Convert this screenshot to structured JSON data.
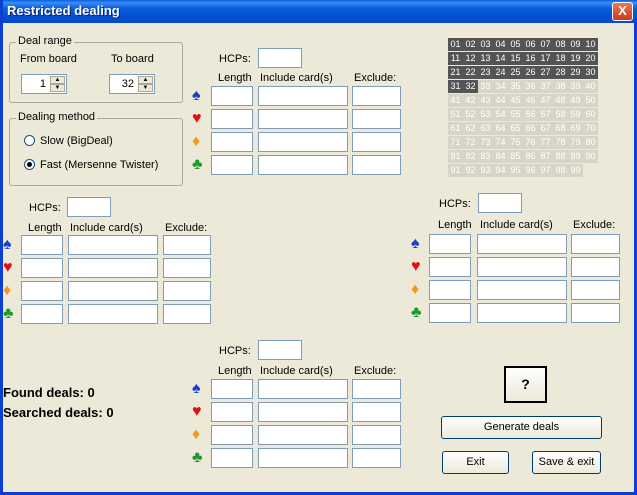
{
  "window": {
    "title": "Restricted dealing",
    "close_glyph": "X"
  },
  "deal_range": {
    "title": "Deal range",
    "from_label": "From board",
    "to_label": "To board",
    "from_value": "1",
    "to_value": "32"
  },
  "dealing_method": {
    "title": "Dealing method",
    "options": [
      {
        "label": "Slow (BigDeal)",
        "selected": false
      },
      {
        "label": "Fast (Mersenne Twister)",
        "selected": true
      }
    ]
  },
  "hand_labels": {
    "hcps": "HCPs:",
    "length": "Length",
    "include": "Include card(s)",
    "exclude": "Exclude:"
  },
  "suits": [
    {
      "glyph": "♠",
      "color": "#1a3fcf"
    },
    {
      "glyph": "♥",
      "color": "#e01010"
    },
    {
      "glyph": "♦",
      "color": "#f39a1c"
    },
    {
      "glyph": "♣",
      "color": "#1e9a2a"
    }
  ],
  "board_grid": {
    "cells": [
      "01",
      "02",
      "03",
      "04",
      "05",
      "06",
      "07",
      "08",
      "09",
      "10",
      "11",
      "12",
      "13",
      "14",
      "15",
      "16",
      "17",
      "18",
      "19",
      "20",
      "21",
      "22",
      "23",
      "24",
      "25",
      "26",
      "27",
      "28",
      "29",
      "30",
      "31",
      "32",
      "33",
      "34",
      "35",
      "36",
      "37",
      "38",
      "39",
      "40",
      "41",
      "42",
      "43",
      "44",
      "45",
      "46",
      "47",
      "48",
      "49",
      "50",
      "51",
      "52",
      "53",
      "54",
      "55",
      "56",
      "57",
      "58",
      "59",
      "60",
      "61",
      "62",
      "63",
      "64",
      "65",
      "66",
      "67",
      "68",
      "69",
      "70",
      "71",
      "72",
      "73",
      "74",
      "75",
      "76",
      "77",
      "78",
      "79",
      "80",
      "81",
      "82",
      "83",
      "84",
      "85",
      "86",
      "87",
      "88",
      "89",
      "90",
      "91",
      "92",
      "93",
      "94",
      "95",
      "96",
      "97",
      "98",
      "99"
    ],
    "active_count": 32,
    "active_color": "#545454",
    "inactive_color": "#d8d5c7"
  },
  "stats": {
    "found": "Found deals: 0",
    "searched": "Searched deals: 0"
  },
  "buttons": {
    "help": "?",
    "generate": "Generate deals",
    "exit": "Exit",
    "save_exit": "Save & exit"
  }
}
